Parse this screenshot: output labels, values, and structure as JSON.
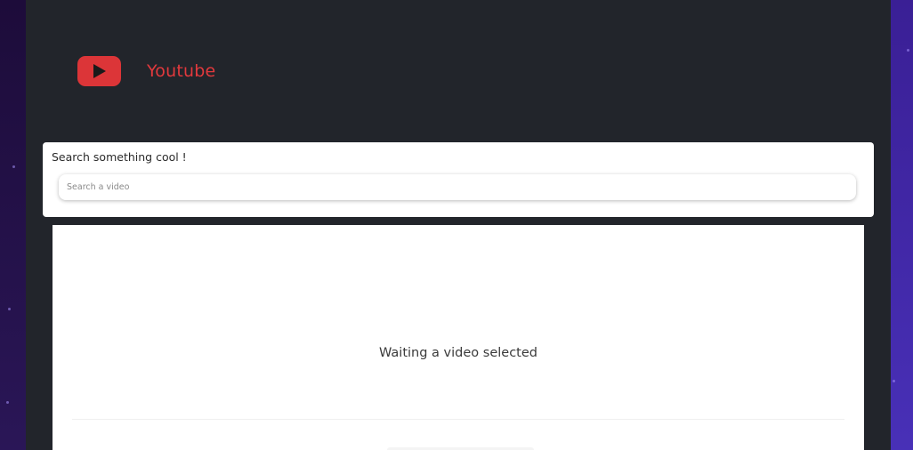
{
  "app": {
    "brand_name": "Youtube",
    "brand_color": "#e2393d",
    "logo_icon": "youtube-play-icon"
  },
  "search": {
    "label": "Search something cool !",
    "placeholder": "Search a video",
    "value": ""
  },
  "player": {
    "status_text": "Waiting a video selected"
  },
  "colors": {
    "page_background": "#22252b",
    "accent_red": "#dc3538",
    "left_edge": "#1d0c3a",
    "right_edge": "#4830b7"
  }
}
